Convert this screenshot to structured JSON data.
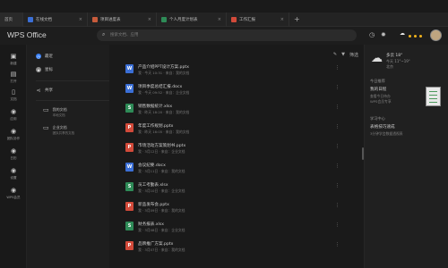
{
  "tabs": [
    {
      "label": "首页",
      "color": "#2a2a2a"
    },
    {
      "label": "在线文档",
      "color": "#3b6fd6"
    },
    {
      "label": "项目进度表",
      "color": "#c75b3b"
    },
    {
      "label": "个人月度计划表",
      "color": "#2e8b57"
    },
    {
      "label": "工作汇报",
      "color": "#d24a3a"
    }
  ],
  "header": {
    "brand": "WPS Office",
    "search_placeholder": "搜索文档、应用"
  },
  "rail": [
    {
      "icon": "new-icon",
      "label": "新建"
    },
    {
      "icon": "open-icon",
      "label": "打开"
    },
    {
      "icon": "doc-icon",
      "label": "文档"
    },
    {
      "icon": "apps-icon",
      "label": "应用"
    },
    {
      "icon": "team-icon",
      "label": "团队协作"
    },
    {
      "icon": "calendar-icon",
      "label": "日历"
    },
    {
      "icon": "settings-icon",
      "label": "设置"
    },
    {
      "icon": "wps-icon",
      "label": "WPS会员"
    }
  ],
  "nav": {
    "items": [
      {
        "label": "最近",
        "color": "#3b82f6"
      },
      {
        "label": "星标",
        "color": "#8a8a8a"
      },
      {
        "label": "共享",
        "color": "#8a8a8a"
      }
    ],
    "folders": [
      {
        "title": "我的文档",
        "sub": "本地文档"
      },
      {
        "title": "企业文档",
        "sub": "团队共享的文档"
      }
    ]
  },
  "files_toolbar": {
    "filter_label": "筛选"
  },
  "files": [
    {
      "type": "W",
      "color": "#3b6fd6",
      "name": "产品介绍PPT设计方案.pptx",
      "meta": "我 · 今天 10:31 · 来自：我的文档"
    },
    {
      "type": "W",
      "color": "#3b6fd6",
      "name": "项目季度总结汇报.docx",
      "meta": "我 · 今天 09:52 · 来自：企业文档"
    },
    {
      "type": "S",
      "color": "#2e8b57",
      "name": "销售数据统计.xlsx",
      "meta": "我 · 昨天 18:20 · 来自：我的文档"
    },
    {
      "type": "P",
      "color": "#d24a3a",
      "name": "年度工作规划.pptx",
      "meta": "我 · 昨天 16:05 · 来自：我的文档"
    },
    {
      "type": "P",
      "color": "#d24a3a",
      "name": "市场活动方案策划书.pptx",
      "meta": "我 · 3月12日 · 来自：企业文档"
    },
    {
      "type": "W",
      "color": "#3b6fd6",
      "name": "会议纪要.docx",
      "meta": "我 · 3月11日 · 来自：我的文档"
    },
    {
      "type": "S",
      "color": "#2e8b57",
      "name": "员工考勤表.xlsx",
      "meta": "我 · 3月10日 · 来自：企业文档"
    },
    {
      "type": "P",
      "color": "#d24a3a",
      "name": "新品发布会.pptx",
      "meta": "我 · 3月09日 · 来自：我的文档"
    },
    {
      "type": "S",
      "color": "#2e8b57",
      "name": "财务报表.xlsx",
      "meta": "我 · 3月08日 · 来自：企业文档"
    },
    {
      "type": "P",
      "color": "#d24a3a",
      "name": "品牌推广方案.pptx",
      "meta": "我 · 3月07日 · 来自：我的文档"
    }
  ],
  "right": {
    "weather_title": "多云 18°",
    "weather_sub1": "今天 11°~19°",
    "weather_sub2": "北京",
    "section1": "今日推荐",
    "rec_title": "我的日程",
    "rec_sub1": "查看今日待办",
    "rec_sub2": "WPS会员专享",
    "section2": "学习中心",
    "learn_title": "表格技巧速成",
    "learn_sub": "3分钟学会数据透视表"
  }
}
